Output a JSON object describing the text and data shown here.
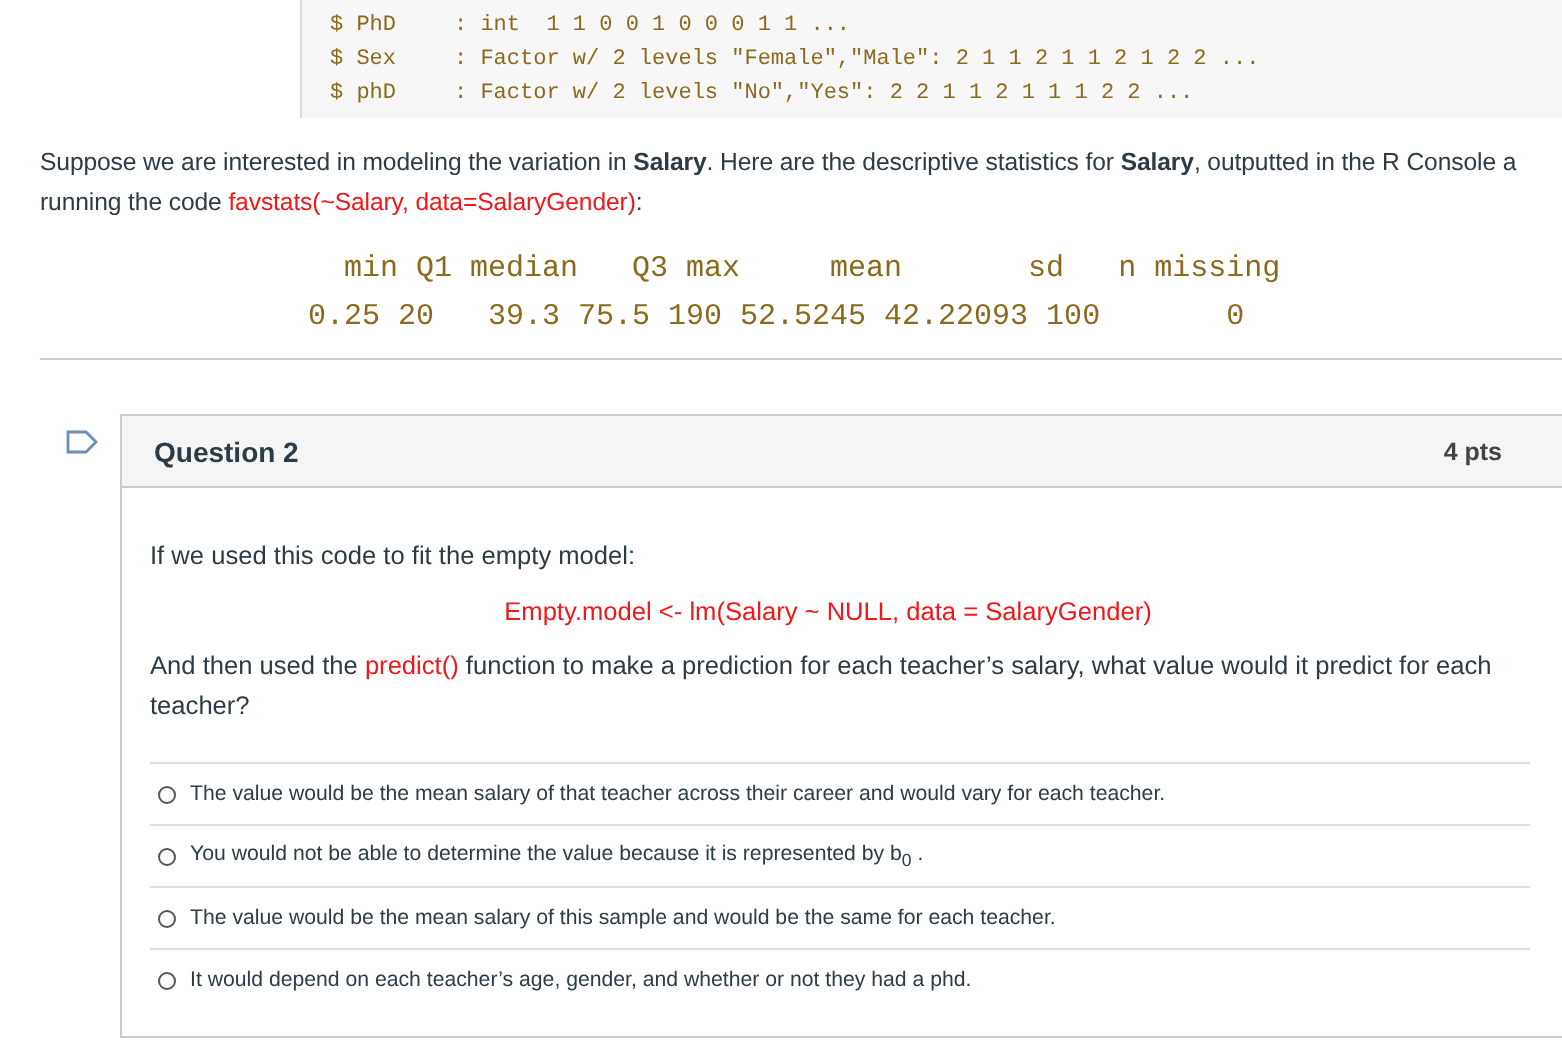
{
  "structure_output": [
    {
      "name": "$ PhD",
      "desc": ": int  1 1 0 0 1 0 0 0 1 1 ..."
    },
    {
      "name": "$ Sex",
      "desc": ": Factor w/ 2 levels \"Female\",\"Male\": 2 1 1 2 1 1 2 1 2 2 ..."
    },
    {
      "name": "$ phD",
      "desc": ": Factor w/ 2 levels \"No\",\"Yes\": 2 2 1 1 2 1 1 1 2 2 ..."
    }
  ],
  "intro": {
    "lines": [
      [
        {
          "kind": "text",
          "text": "Suppose we are interested in modeling the variation in **Salary**.  Here are the descriptive statistics for **Salary**, outputted in the R Console a"
        }
      ],
      [
        {
          "kind": "text",
          "text": "running the code "
        },
        {
          "kind": "code",
          "text": "favstats(~Salary, data=SalaryGender)"
        },
        {
          "kind": "text",
          "text": ":"
        }
      ]
    ]
  },
  "stats_output": [
    "  min Q1 median   Q3 max     mean       sd   n missing",
    "0.25 20   39.3 75.5 190 52.5245 42.22093 100       0"
  ],
  "question": {
    "title": "Question 2",
    "points": "4 pts",
    "prompt": "If we used this code to fit the empty model:",
    "code": "Empty.model <- lm(Salary ~ NULL, data = SalaryGender)",
    "body": [
      {
        "kind": "text",
        "text": "And then used the "
      },
      {
        "kind": "code",
        "text": "predict()"
      },
      {
        "kind": "text",
        "text": " function to make a prediction for each teacher’s salary, what value would it predict for each teacher?"
      }
    ],
    "answers": [
      {
        "text": "The value would be the mean salary of that teacher across their career and would vary for each teacher.",
        "selected": false
      },
      {
        "text": "You would not be able to determine the value because it is represented by b$_{0}$ .",
        "selected": false
      },
      {
        "text": "The value would be the mean salary of this sample and would be the same for each teacher.",
        "selected": false
      },
      {
        "text": "It would depend on each teacher’s age, gender, and whether or not they had a phd.",
        "selected": false
      }
    ]
  }
}
